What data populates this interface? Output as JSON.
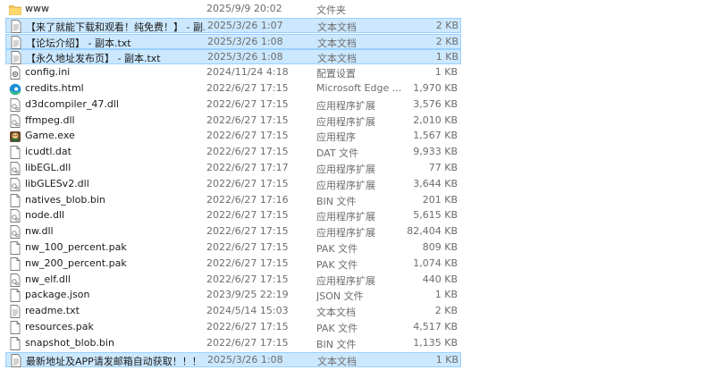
{
  "files": [
    {
      "name": "www",
      "date": "2025/9/9 20:02",
      "type": "文件夹",
      "size": "",
      "icon": "folder-icon",
      "selected": false
    },
    {
      "name": "【来了就能下载和观看！纯免费！】 - 副...",
      "date": "2025/3/26 1:07",
      "type": "文本文档",
      "size": "2 KB",
      "icon": "text-file-icon",
      "selected": true
    },
    {
      "name": "【论坛介绍】 - 副本.txt",
      "date": "2025/3/26 1:08",
      "type": "文本文档",
      "size": "2 KB",
      "icon": "text-file-icon",
      "selected": true
    },
    {
      "name": "【永久地址发布页】 - 副本.txt",
      "date": "2025/3/26 1:08",
      "type": "文本文档",
      "size": "1 KB",
      "icon": "text-file-icon",
      "selected": true
    },
    {
      "name": "config.ini",
      "date": "2024/11/24 4:18",
      "type": "配置设置",
      "size": "1 KB",
      "icon": "settings-file-icon",
      "selected": false
    },
    {
      "name": "credits.html",
      "date": "2022/6/27 17:15",
      "type": "Microsoft Edge ...",
      "size": "1,970 KB",
      "icon": "edge-icon",
      "selected": false
    },
    {
      "name": "d3dcompiler_47.dll",
      "date": "2022/6/27 17:15",
      "type": "应用程序扩展",
      "size": "3,576 KB",
      "icon": "dll-file-icon",
      "selected": false
    },
    {
      "name": "ffmpeg.dll",
      "date": "2022/6/27 17:15",
      "type": "应用程序扩展",
      "size": "2,010 KB",
      "icon": "dll-file-icon",
      "selected": false
    },
    {
      "name": "Game.exe",
      "date": "2022/6/27 17:15",
      "type": "应用程序",
      "size": "1,567 KB",
      "icon": "game-exe-icon",
      "selected": false
    },
    {
      "name": "icudtl.dat",
      "date": "2022/6/27 17:15",
      "type": "DAT 文件",
      "size": "9,933 KB",
      "icon": "file-icon",
      "selected": false
    },
    {
      "name": "libEGL.dll",
      "date": "2022/6/27 17:17",
      "type": "应用程序扩展",
      "size": "77 KB",
      "icon": "dll-file-icon",
      "selected": false
    },
    {
      "name": "libGLESv2.dll",
      "date": "2022/6/27 17:15",
      "type": "应用程序扩展",
      "size": "3,644 KB",
      "icon": "dll-file-icon",
      "selected": false
    },
    {
      "name": "natives_blob.bin",
      "date": "2022/6/27 17:16",
      "type": "BIN 文件",
      "size": "201 KB",
      "icon": "file-icon",
      "selected": false
    },
    {
      "name": "node.dll",
      "date": "2022/6/27 17:15",
      "type": "应用程序扩展",
      "size": "5,615 KB",
      "icon": "dll-file-icon",
      "selected": false
    },
    {
      "name": "nw.dll",
      "date": "2022/6/27 17:15",
      "type": "应用程序扩展",
      "size": "82,404 KB",
      "icon": "dll-file-icon",
      "selected": false
    },
    {
      "name": "nw_100_percent.pak",
      "date": "2022/6/27 17:15",
      "type": "PAK 文件",
      "size": "809 KB",
      "icon": "file-icon",
      "selected": false
    },
    {
      "name": "nw_200_percent.pak",
      "date": "2022/6/27 17:15",
      "type": "PAK 文件",
      "size": "1,074 KB",
      "icon": "file-icon",
      "selected": false
    },
    {
      "name": "nw_elf.dll",
      "date": "2022/6/27 17:15",
      "type": "应用程序扩展",
      "size": "440 KB",
      "icon": "dll-file-icon",
      "selected": false
    },
    {
      "name": "package.json",
      "date": "2023/9/25 22:19",
      "type": "JSON 文件",
      "size": "1 KB",
      "icon": "file-icon",
      "selected": false
    },
    {
      "name": "readme.txt",
      "date": "2024/5/14 15:03",
      "type": "文本文档",
      "size": "2 KB",
      "icon": "text-file-icon",
      "selected": false
    },
    {
      "name": "resources.pak",
      "date": "2022/6/27 17:15",
      "type": "PAK 文件",
      "size": "4,517 KB",
      "icon": "file-icon",
      "selected": false
    },
    {
      "name": "snapshot_blob.bin",
      "date": "2022/6/27 17:15",
      "type": "BIN 文件",
      "size": "1,135 KB",
      "icon": "file-icon",
      "selected": false
    },
    {
      "name": "最新地址及APP请发邮箱自动获取！！！",
      "date": "2025/3/26 1:08",
      "type": "文本文档",
      "size": "1 KB",
      "icon": "text-file-icon",
      "selected": true
    }
  ],
  "colors": {
    "selected_bg": "#cce8ff",
    "selected_border": "#99d1ff",
    "folder": "#f2c55c",
    "secondary_text": "#6d6d6d"
  }
}
